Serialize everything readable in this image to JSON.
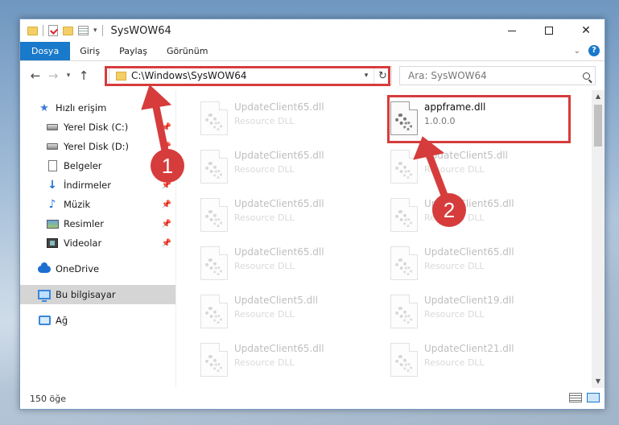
{
  "window": {
    "title": "SysWOW64",
    "controls": {
      "minimize": "minimize-icon",
      "maximize": "maximize-icon",
      "close": "✕"
    }
  },
  "ribbon": {
    "tabs": [
      "Dosya",
      "Giriş",
      "Paylaş",
      "Görünüm"
    ],
    "help": "?"
  },
  "address": {
    "path": "C:\\Windows\\SysWOW64",
    "search_placeholder": "Ara: SysWOW64"
  },
  "sidebar": {
    "items": [
      {
        "label": "Hızlı erişim",
        "icon": "star-icon",
        "pinned": false
      },
      {
        "label": "Yerel Disk (C:)",
        "icon": "drive-icon",
        "pinned": true
      },
      {
        "label": "Yerel Disk (D:)",
        "icon": "drive-icon",
        "pinned": true
      },
      {
        "label": "Belgeler",
        "icon": "documents-icon",
        "pinned": true
      },
      {
        "label": "İndirmeler",
        "icon": "downloads-icon",
        "pinned": true
      },
      {
        "label": "Müzik",
        "icon": "music-icon",
        "pinned": true
      },
      {
        "label": "Resimler",
        "icon": "pictures-icon",
        "pinned": true
      },
      {
        "label": "Videolar",
        "icon": "videos-icon",
        "pinned": true
      },
      {
        "label": "OneDrive",
        "icon": "onedrive-icon",
        "pinned": false
      },
      {
        "label": "Bu bilgisayar",
        "icon": "this-pc-icon",
        "pinned": false,
        "selected": true
      },
      {
        "label": "Ağ",
        "icon": "network-icon",
        "pinned": false
      }
    ]
  },
  "files": {
    "left_column": [
      {
        "name": "UpdateClient65.dll",
        "desc": "Resource DLL"
      },
      {
        "name": "UpdateClient65.dll",
        "desc": "Resource DLL"
      },
      {
        "name": "UpdateClient65.dll",
        "desc": "Resource DLL"
      },
      {
        "name": "UpdateClient65.dll",
        "desc": "Resource DLL"
      },
      {
        "name": "UpdateClient5.dll",
        "desc": "Resource DLL"
      },
      {
        "name": "UpdateClient65.dll",
        "desc": "Resource DLL"
      }
    ],
    "right_column": [
      {
        "name": "appframe.dll",
        "desc": "1.0.0.0",
        "highlighted": true
      },
      {
        "name": "UpdateClient5.dll",
        "desc": "Resource DLL"
      },
      {
        "name": "UpdateClient65.dll",
        "desc": "Resource DLL"
      },
      {
        "name": "UpdateClient65.dll",
        "desc": "Resource DLL"
      },
      {
        "name": "UpdateClient19.dll",
        "desc": "Resource DLL"
      },
      {
        "name": "UpdateClient21.dll",
        "desc": "Resource DLL"
      }
    ]
  },
  "status": {
    "item_count": "150 öğe"
  },
  "annotations": {
    "step1": "1",
    "step2": "2",
    "color": "#d63c3c"
  }
}
